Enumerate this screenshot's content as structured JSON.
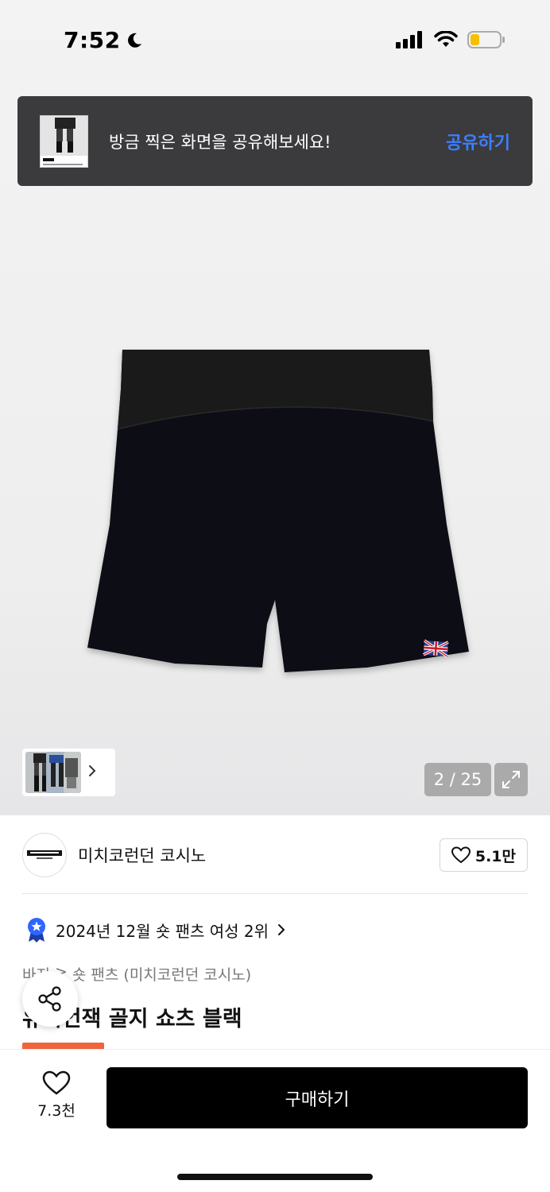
{
  "status": {
    "time": "7:52"
  },
  "toast": {
    "text": "방금 찍은 화면을 공유해보세요!",
    "action": "공유하기"
  },
  "gallery": {
    "counter": "2 / 25"
  },
  "brand": {
    "name": "미치코런던 코시노",
    "likes": "5.1만"
  },
  "ranking": {
    "text": "2024년 12월 숏 팬츠 여성 2위"
  },
  "breadcrumb": {
    "category": "바지",
    "separator": ">",
    "subcategory": "숏 팬츠 (미치코런던 코시노)"
  },
  "product": {
    "title": "유니언잭 골지 쇼츠 블랙"
  },
  "bottom": {
    "wish_count": "7.3천",
    "buy_label": "구매하기"
  },
  "colors": {
    "accent": "#3d7eff",
    "buy": "#000000",
    "tag": "#f0643c"
  }
}
